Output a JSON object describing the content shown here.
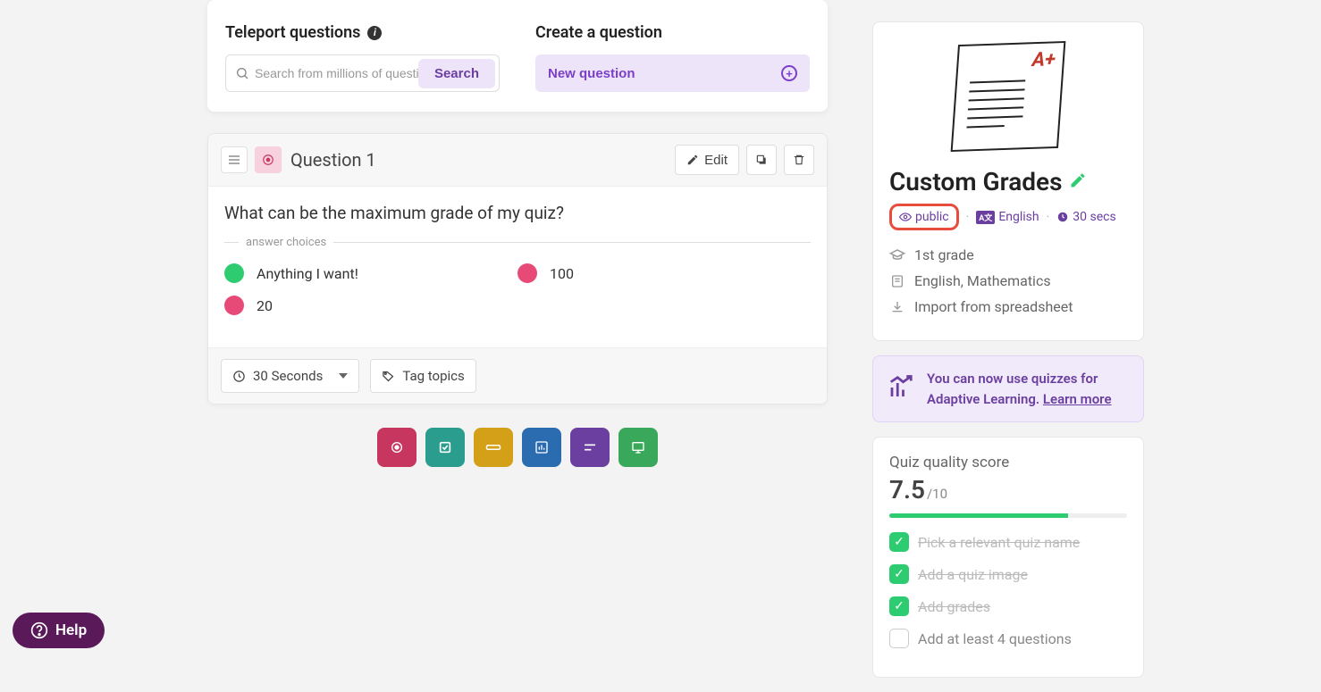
{
  "top": {
    "teleport_heading": "Teleport questions",
    "search_placeholder": "Search from millions of questions",
    "search_button": "Search",
    "create_heading": "Create a question",
    "new_question_label": "New question"
  },
  "question": {
    "title": "Question 1",
    "edit_label": "Edit",
    "text": "What can be the maximum grade of my quiz?",
    "answer_divider": "answer choices",
    "answers": [
      {
        "text": "Anything I want!",
        "correct": true
      },
      {
        "text": "100",
        "correct": false
      },
      {
        "text": "20",
        "correct": false
      }
    ],
    "time_label": "30 Seconds",
    "tag_label": "Tag topics"
  },
  "sidebar": {
    "quiz_name": "Custom Grades",
    "visibility": "public",
    "language": "English",
    "time": "30 secs",
    "grade_level": "1st grade",
    "subjects": "English, Mathematics",
    "import_label": "Import from spreadsheet",
    "adaptive_text": "You can now use quizzes for Adaptive Learning. ",
    "learn_more": "Learn more",
    "quality_heading": "Quiz quality score",
    "score": "7.5",
    "score_denom": "/10",
    "checklist": [
      {
        "label": "Pick a relevant quiz name",
        "done": true
      },
      {
        "label": "Add a quiz image",
        "done": true
      },
      {
        "label": "Add grades",
        "done": true
      },
      {
        "label": "Add at least 4 questions",
        "done": false
      }
    ]
  },
  "help_label": "Help"
}
